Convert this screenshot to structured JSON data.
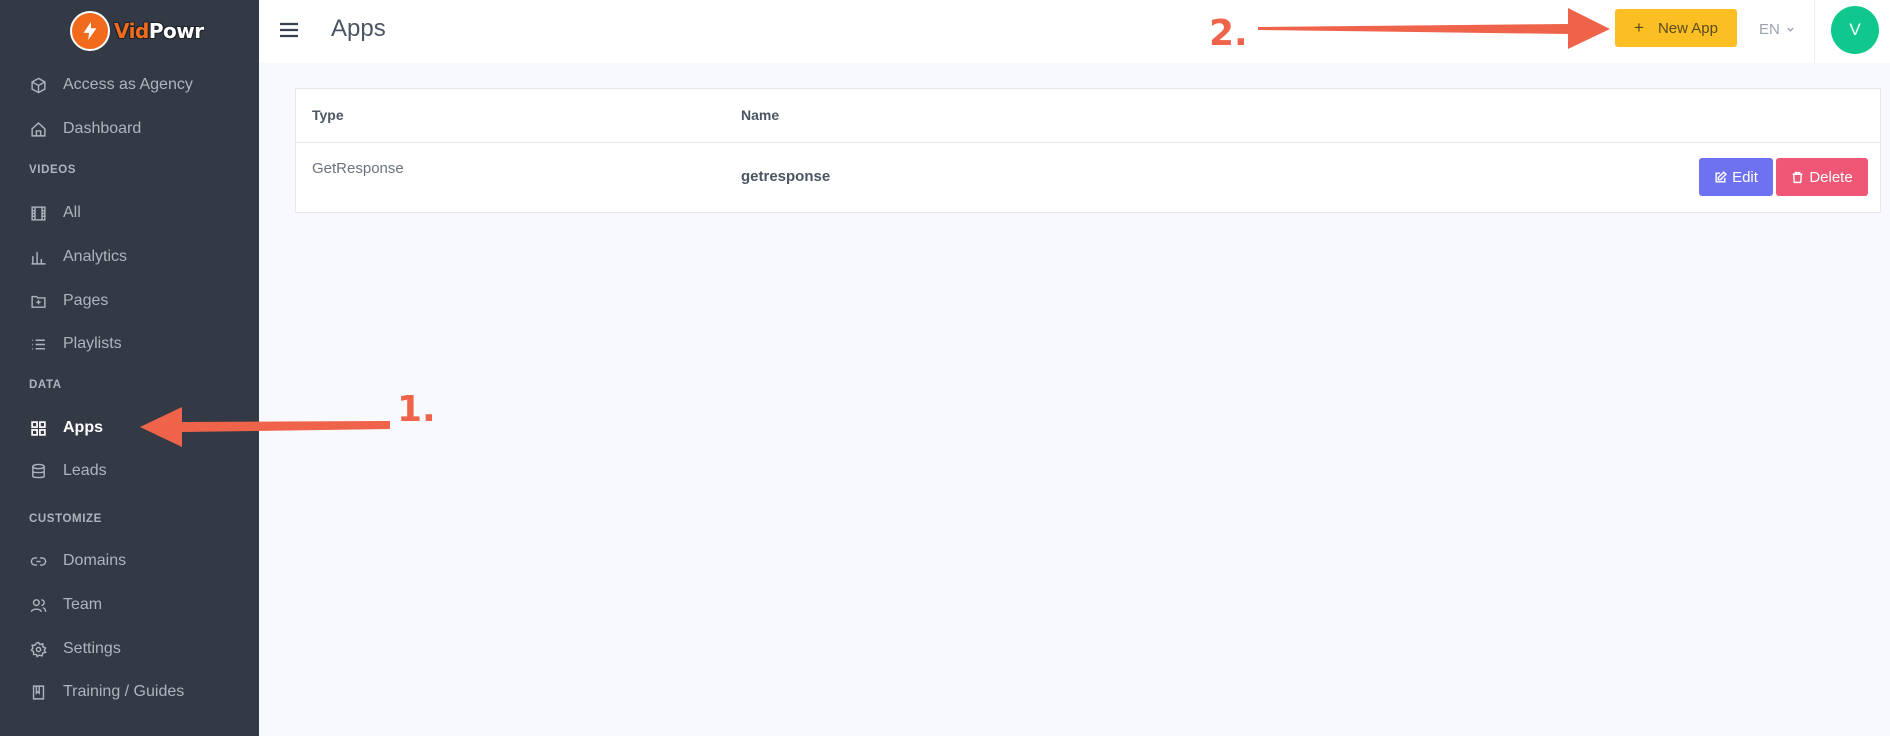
{
  "brand": {
    "name_a": "Vid",
    "name_b": "Powr",
    "accent": "#f26b1d"
  },
  "sidebar": {
    "items": [
      {
        "label": "Access as Agency",
        "icon": "cube-icon"
      },
      {
        "label": "Dashboard",
        "icon": "home-icon"
      },
      {
        "label": "All",
        "icon": "film-icon"
      },
      {
        "label": "Analytics",
        "icon": "bar-chart-icon"
      },
      {
        "label": "Pages",
        "icon": "file-plus-icon"
      },
      {
        "label": "Playlists",
        "icon": "list-icon"
      },
      {
        "label": "Apps",
        "icon": "grid-icon",
        "active": true
      },
      {
        "label": "Leads",
        "icon": "database-icon"
      },
      {
        "label": "Domains",
        "icon": "link-icon"
      },
      {
        "label": "Team",
        "icon": "users-icon"
      },
      {
        "label": "Settings",
        "icon": "gear-icon"
      },
      {
        "label": "Training / Guides",
        "icon": "book-icon"
      }
    ],
    "sections": [
      "VIDEOS",
      "DATA",
      "CUSTOMIZE"
    ]
  },
  "header": {
    "title": "Apps",
    "new_app_label": "New App",
    "new_app_icon": "+",
    "language": "EN",
    "avatar_initial": "V"
  },
  "table": {
    "columns": [
      "Type",
      "Name"
    ],
    "rows": [
      {
        "type": "GetResponse",
        "name": "getresponse",
        "edit_label": "Edit",
        "delete_label": "Delete"
      }
    ]
  },
  "annotations": {
    "step1": "1.",
    "step2": "2."
  },
  "colors": {
    "sidebar_bg": "#343a45",
    "new_app_bg": "#fbbf24",
    "edit_bg": "#6f72f0",
    "delete_bg": "#f05676",
    "avatar_bg": "#10c88e",
    "annotation": "#f0634b"
  }
}
